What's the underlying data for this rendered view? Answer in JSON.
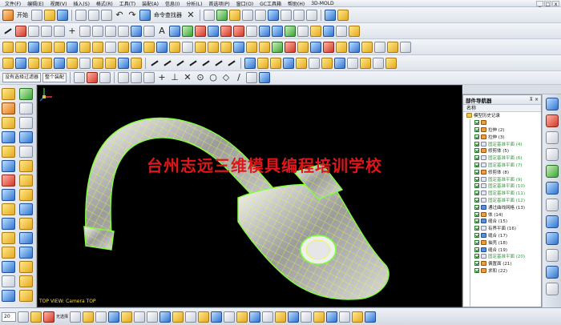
{
  "menubar": {
    "items": [
      "文件(F)",
      "编辑(E)",
      "视图(V)",
      "插入(S)",
      "格式(R)",
      "工具(T)",
      "装配(A)",
      "信息(I)",
      "分析(L)",
      "首选项(P)",
      "窗口(O)",
      "GC工具箱",
      "帮助(H)",
      "3D-MOLD"
    ],
    "window_controls": [
      "_",
      "□",
      "x"
    ]
  },
  "toolbar_main": {
    "start_label": "开始",
    "command_finder_label": "命令查找器"
  },
  "selection_bar": {
    "filter_value": "没有选择过滤器",
    "scope_value": "整个装配"
  },
  "viewport": {
    "watermark": "台州志远三维模具编程培训学校",
    "view_name": "TOP VIEW: Camera TOP",
    "background": "#000000",
    "mesh_color": "#7cff3a",
    "grid_color": "#e8ff3a"
  },
  "navigator": {
    "title": "部件导航器",
    "column_name": "名称",
    "root": "模型历史记录",
    "items": [
      {
        "label": "",
        "icon": "feat",
        "style": "green"
      },
      {
        "label": "拉伸 (2)",
        "icon": "feat",
        "style": "dim"
      },
      {
        "label": "拉伸 (3)",
        "icon": "feat",
        "style": "dim"
      },
      {
        "label": "固定基准平面 (4)",
        "icon": "plane",
        "style": "green"
      },
      {
        "label": "修剪体 (5)",
        "icon": "feat",
        "style": "dim"
      },
      {
        "label": "固定基准平面 (6)",
        "icon": "plane",
        "style": "green"
      },
      {
        "label": "固定基准平面 (7)",
        "icon": "plane",
        "style": "green"
      },
      {
        "label": "修剪体 (8)",
        "icon": "feat",
        "style": "dim"
      },
      {
        "label": "固定基准平面 (9)",
        "icon": "plane",
        "style": "green"
      },
      {
        "label": "固定基准平面 (10)",
        "icon": "plane",
        "style": "green"
      },
      {
        "label": "固定基准平面 (11)",
        "icon": "plane",
        "style": "green"
      },
      {
        "label": "固定基准平面 (12)",
        "icon": "plane",
        "style": "green"
      },
      {
        "label": "通过曲线网格 (13)",
        "icon": "mesh",
        "style": "dim"
      },
      {
        "label": "体 (14)",
        "icon": "feat",
        "style": "dim"
      },
      {
        "label": "缝合 (15)",
        "icon": "mesh",
        "style": "dim"
      },
      {
        "label": "有界平面 (16)",
        "icon": "plane",
        "style": "dim"
      },
      {
        "label": "缝合 (17)",
        "icon": "mesh",
        "style": "dim"
      },
      {
        "label": "抽壳 (18)",
        "icon": "feat",
        "style": "dim"
      },
      {
        "label": "缝合 (19)",
        "icon": "mesh",
        "style": "dim"
      },
      {
        "label": "固定基准平面 (20)",
        "icon": "plane",
        "style": "green"
      },
      {
        "label": "偏置面 (21)",
        "icon": "feat",
        "style": "dim"
      },
      {
        "label": "求和 (22)",
        "icon": "feat",
        "style": "dim"
      }
    ],
    "pin": "⊼ ×"
  },
  "bottom_bar": {
    "zoom_value": "20",
    "label": "无选择"
  },
  "icons": {
    "start": "start-icon",
    "new": "new-file-icon",
    "open": "open-folder-icon",
    "save": "save-icon",
    "undo": "undo-icon",
    "redo": "redo-icon"
  }
}
